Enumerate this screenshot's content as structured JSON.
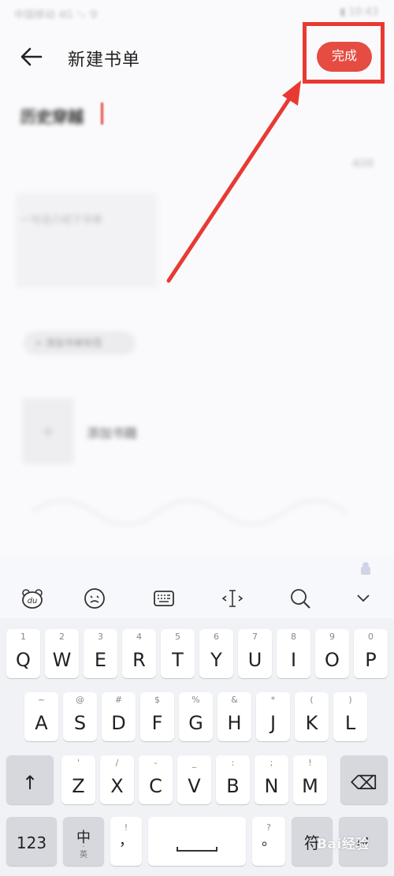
{
  "status_bar": {
    "carrier": "中国移动 4G ⁺ᵢₗ 令",
    "right": "▮ 10:43"
  },
  "header": {
    "title": "新建书单",
    "done_label": "完成"
  },
  "form": {
    "booklist_name": "历史穿越",
    "name_counter": "4/20",
    "description_placeholder": "一句话介绍下书单",
    "tag_chip": "+ 添加书单标签",
    "add_book_label": "添加书籍",
    "add_book_plus": "+"
  },
  "keyboard": {
    "toolbar": [
      "du-icon",
      "emoji-icon",
      "keyboard-icon",
      "cursor-icon",
      "search-icon",
      "collapse-icon"
    ],
    "row1": [
      {
        "main": "Q",
        "sub": "1"
      },
      {
        "main": "W",
        "sub": "2"
      },
      {
        "main": "E",
        "sub": "3"
      },
      {
        "main": "R",
        "sub": "4"
      },
      {
        "main": "T",
        "sub": "5"
      },
      {
        "main": "Y",
        "sub": "6"
      },
      {
        "main": "U",
        "sub": "7"
      },
      {
        "main": "I",
        "sub": "8"
      },
      {
        "main": "O",
        "sub": "9"
      },
      {
        "main": "P",
        "sub": "0"
      }
    ],
    "row2": [
      {
        "main": "A",
        "sub": "~"
      },
      {
        "main": "S",
        "sub": "@"
      },
      {
        "main": "D",
        "sub": "#"
      },
      {
        "main": "F",
        "sub": "$"
      },
      {
        "main": "G",
        "sub": "%"
      },
      {
        "main": "H",
        "sub": "&"
      },
      {
        "main": "J",
        "sub": "*"
      },
      {
        "main": "K",
        "sub": "("
      },
      {
        "main": "L",
        "sub": ")"
      }
    ],
    "row3": [
      {
        "main": "Z",
        "sub": "'"
      },
      {
        "main": "X",
        "sub": "/"
      },
      {
        "main": "C",
        "sub": "-"
      },
      {
        "main": "V",
        "sub": "_"
      },
      {
        "main": "B",
        "sub": ":"
      },
      {
        "main": "N",
        "sub": ";"
      },
      {
        "main": "M",
        "sub": "!"
      }
    ],
    "shift_label": "↑",
    "backspace_label": "⌫",
    "num_label": "123",
    "zh_label": "中",
    "zh_dot": "·",
    "zh_small": "英",
    "comma_main": "，",
    "comma_sub": "!",
    "period_main": "。",
    "period_sub": "?",
    "sym_label": "符",
    "enter_label": "↵"
  },
  "watermark": "Bai经验",
  "colors": {
    "accent": "#e54d42",
    "annotation": "#e83a32"
  }
}
